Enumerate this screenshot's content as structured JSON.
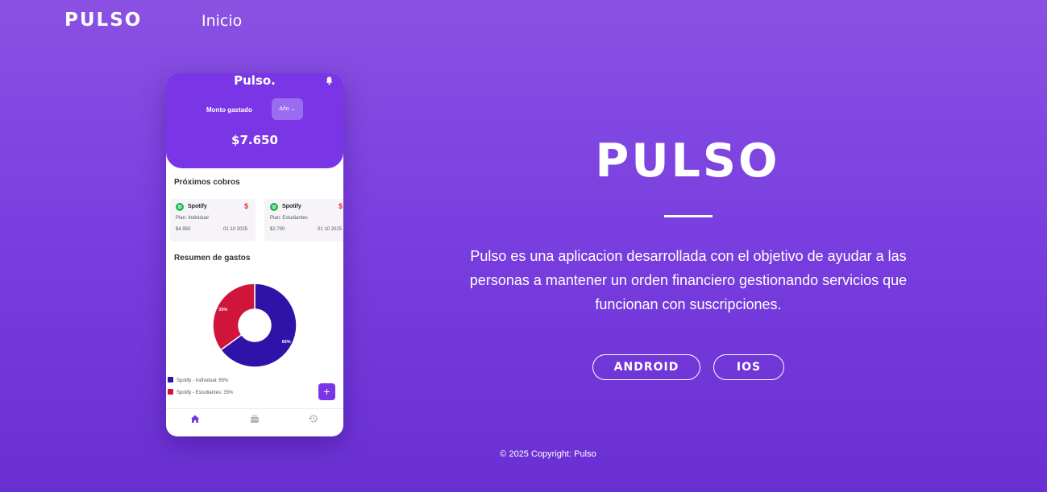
{
  "navbar": {
    "brand": "PULSO",
    "link_home": "Inicio"
  },
  "mockup": {
    "app_logo": "Pulso.",
    "bell_icon": "bell-icon",
    "monto_label": "Monto gastado",
    "year_select": "Año",
    "amount": "$7.650",
    "upcoming_title": "Próximos cobros",
    "cards": [
      {
        "service": "Spotify",
        "plan": "Plan: Individual",
        "price": "$4.950",
        "date": "01 10 2025",
        "currency_icon": "$"
      },
      {
        "service": "Spotify",
        "plan": "Plan: Estudiantes",
        "price": "$2.700",
        "date": "01 10 2025",
        "currency_icon": "$"
      }
    ],
    "summary_title": "Resumen de gastos",
    "chart_data": {
      "type": "pie",
      "title": "",
      "categories": [
        "Spotify - Individual",
        "Spotify - Estudiantes"
      ],
      "values": [
        65,
        35
      ],
      "slice_labels": [
        "65%",
        "35%"
      ],
      "colors": [
        "#2f13a8",
        "#d0143a"
      ],
      "legend_position": "bottom-left"
    },
    "legend": [
      {
        "label": "Spotify - Individual: 65%",
        "color": "#2f13a8"
      },
      {
        "label": "Spotify - Estudiantes: 35%",
        "color": "#d0143a"
      }
    ],
    "fab_label": "+",
    "bottom_nav": [
      "home-icon",
      "briefcase-icon",
      "history-icon"
    ]
  },
  "hero": {
    "title": "PULSO",
    "description": "Pulso es una aplicacion desarrollada con el objetivo de ayudar a las personas a mantener un orden financiero gestionando servicios que funcionan con suscripciones.",
    "android_button": "ANDROID",
    "ios_button": "IOS"
  },
  "footer": {
    "copyright": "© 2025 Copyright: Pulso"
  },
  "colors": {
    "background": "#7f45e1",
    "accent": "#7a36e6",
    "series_individual": "#2f13a8",
    "series_estudiantes": "#d0143a"
  }
}
